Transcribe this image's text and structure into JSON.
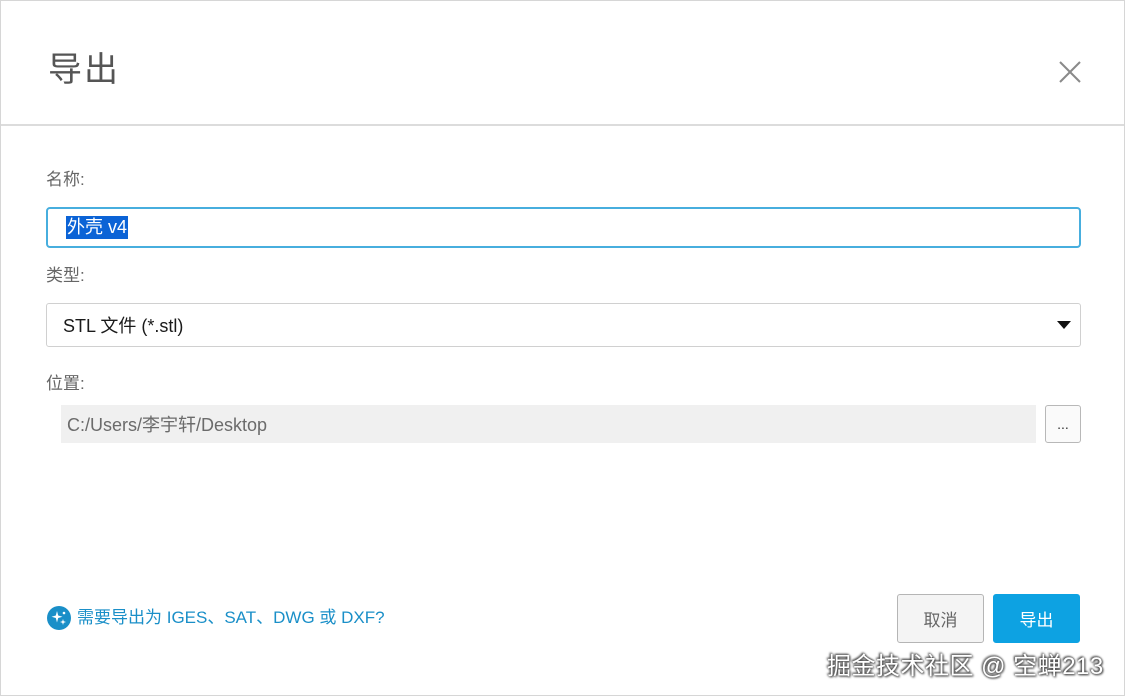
{
  "dialog": {
    "title": "导出",
    "close_icon": "close-icon"
  },
  "name_field": {
    "label": "名称:",
    "value": "外壳 v4"
  },
  "type_field": {
    "label": "类型:",
    "selected": "STL 文件 (*.stl)",
    "arrow_icon": "caret-down-icon"
  },
  "location_field": {
    "label": "位置:",
    "value": "C:/Users/李宇轩/Desktop",
    "browse_label": "..."
  },
  "help": {
    "icon": "sparkle-plus-icon",
    "text": "需要导出为 IGES、SAT、DWG 或 DXF?"
  },
  "buttons": {
    "cancel": "取消",
    "export": "导出"
  },
  "watermark": "掘金技术社区 @ 空蝉213",
  "colors": {
    "accent": "#0da2e2",
    "focus_border": "#47aede",
    "selection": "#0b63d6",
    "link": "#1a8fc8"
  }
}
